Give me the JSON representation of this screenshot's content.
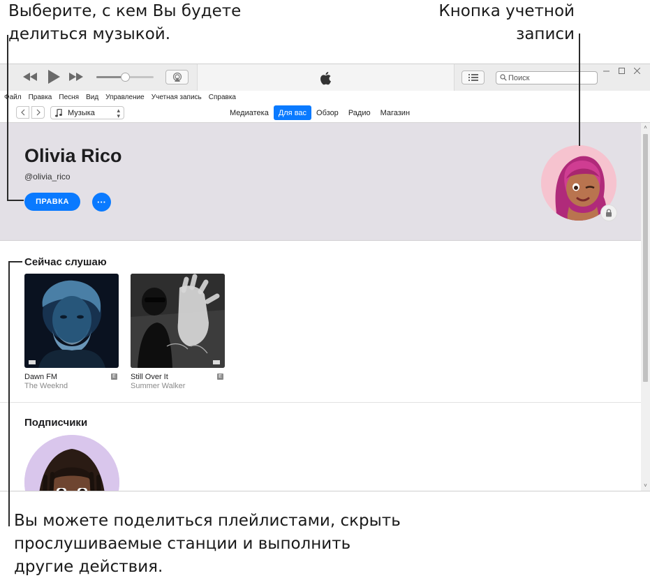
{
  "callouts": {
    "share_music": "Выберите, с кем Вы будете делиться музыкой.",
    "account_button": "Кнопка учетной записи",
    "more_actions": "Вы можете поделиться плейлистами, скрыть прослушиваемые станции и выполнить другие действия."
  },
  "toolbar": {
    "search_placeholder": "Поиск"
  },
  "menu": [
    "Файл",
    "Правка",
    "Песня",
    "Вид",
    "Управление",
    "Учетная запись",
    "Справка"
  ],
  "nav": {
    "media_type": "Музыка",
    "tabs": [
      {
        "label": "Медиатека",
        "active": false
      },
      {
        "label": "Для вас",
        "active": true
      },
      {
        "label": "Обзор",
        "active": false
      },
      {
        "label": "Радио",
        "active": false
      },
      {
        "label": "Магазин",
        "active": false
      }
    ]
  },
  "profile": {
    "name": "Olivia Rico",
    "handle": "@olivia_rico",
    "edit_label": "ПРАВКА",
    "more_label": "···"
  },
  "listening": {
    "title": "Сейчас слушаю",
    "albums": [
      {
        "title": "Dawn FM",
        "artist": "The Weeknd",
        "explicit": "E"
      },
      {
        "title": "Still Over It",
        "artist": "Summer Walker",
        "explicit": "E"
      }
    ]
  },
  "followers": {
    "title": "Подписчики"
  },
  "colors": {
    "accent": "#0a7aff",
    "header_bg": "#e3e0e6",
    "avatar_bg": "#f6c3cf",
    "follower_bg": "#d9c6ec"
  },
  "volume_level": 0.5
}
